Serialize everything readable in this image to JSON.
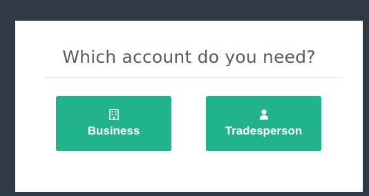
{
  "modal": {
    "title": "Which account do you need?",
    "options": [
      {
        "label": "Business",
        "icon": "building-icon"
      },
      {
        "label": "Tradesperson",
        "icon": "user-icon"
      }
    ]
  },
  "colors": {
    "backdrop": "#2f3a45",
    "button": "#21b38b",
    "title_text": "#555d63"
  }
}
